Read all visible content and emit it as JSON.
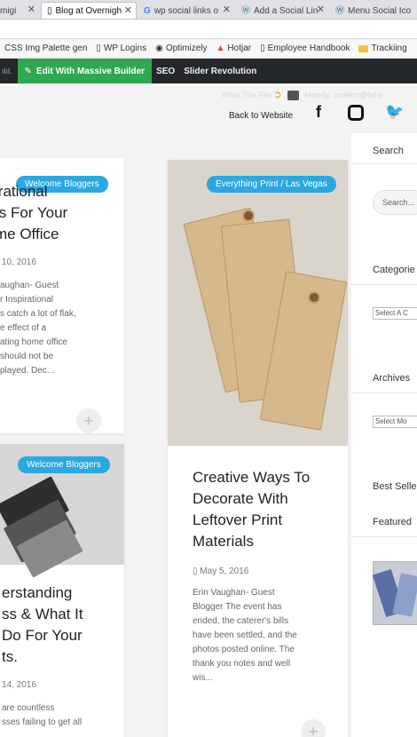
{
  "browser": {
    "tabs": [
      {
        "label": "migi",
        "icon": "page-icon"
      },
      {
        "label": "Blog at Overnigh",
        "icon": "page-icon"
      },
      {
        "label": "wp social links o",
        "icon": "google-icon"
      },
      {
        "label": "Add a Social Lin",
        "icon": "wordpress-icon"
      },
      {
        "label": "Menu Social Ico",
        "icon": "wordpress-icon"
      }
    ],
    "bookmarks": [
      {
        "label": "CSS Img Palette gen"
      },
      {
        "label": "WP Logins"
      },
      {
        "label": "Optimizely"
      },
      {
        "label": "Hotjar"
      },
      {
        "label": "Employee Handbook"
      },
      {
        "label": "Trackiing"
      }
    ]
  },
  "adminbar": {
    "massive": "Edit With Massive Builder",
    "seo": "SEO",
    "slider": "Slider Revolution"
  },
  "header": {
    "faded_what": "What The File",
    "faded_howdy": "Howdy, content@fahe",
    "back": "Back to Website"
  },
  "posts": {
    "p1": {
      "badge": "Welcome Bloggers",
      "title1": "irational",
      "title2": "ts For Your",
      "title3": "me Office",
      "date": "10, 2016",
      "ex1": "aughan- Guest",
      "ex2": "r Inspirational",
      "ex3": "s catch a lot of flak,",
      "ex4": "e effect of a",
      "ex5": "ating home office",
      "ex6": "should not be",
      "ex7": "played. Dec..."
    },
    "p2": {
      "badge": "Everything Print / Las Vegas",
      "title1": "Creative Ways To",
      "title2": "Decorate With",
      "title3": "Leftover Print",
      "title4": "Materials",
      "date": "May 5, 2016",
      "ex1": "Erin Vaughan- Guest",
      "ex2": "Blogger The event has",
      "ex3": "ended, the caterer's bills",
      "ex4": "have been settled, and the",
      "ex5": "photos posted online. The",
      "ex6": "thank you notes and well",
      "ex7": "wis..."
    },
    "p3": {
      "badge": "Welcome Bloggers",
      "title1": "erstanding",
      "title2": "ss & What It",
      "title3": "Do For Your",
      "title4": "ts.",
      "date": "14, 2016",
      "ex1": "are countless",
      "ex2": "sses failing to get all"
    }
  },
  "sidebar": {
    "search": "Search",
    "search_placeholder": "Search...",
    "categories": "Categorie",
    "select_category": "Select A C",
    "archives": "Archives",
    "select_month": "Select Mo",
    "best_sellers": "Best Selle",
    "featured": "Featured"
  },
  "colors": {
    "accent": "#2aa8e0",
    "admin_bg": "#23282d",
    "massive_green": "#2fa84f"
  }
}
